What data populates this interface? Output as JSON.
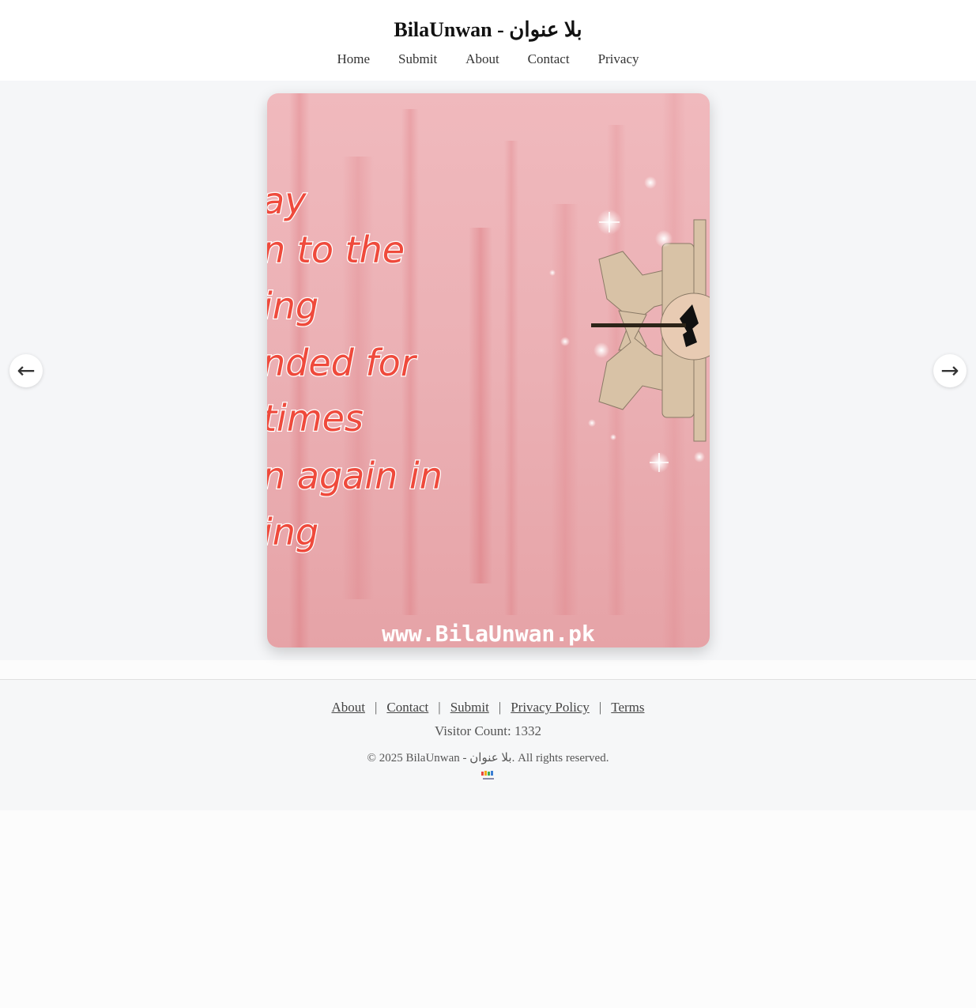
{
  "site": {
    "title": "BilaUnwan - بلا عنوان"
  },
  "nav": {
    "items": [
      {
        "label": "Home"
      },
      {
        "label": "Submit"
      },
      {
        "label": "About"
      },
      {
        "label": "Contact"
      },
      {
        "label": "Privacy"
      }
    ]
  },
  "slider": {
    "image_text_lines": [
      "ay",
      "n to the",
      "ing",
      "nded  for",
      "times",
      "n again in",
      "ing"
    ],
    "watermark": "www.BilaUnwan.pk",
    "prev_icon": "←",
    "next_icon": "→"
  },
  "footer": {
    "links": [
      {
        "label": "About"
      },
      {
        "label": "Contact"
      },
      {
        "label": "Submit"
      },
      {
        "label": "Privacy Policy"
      },
      {
        "label": "Terms"
      }
    ],
    "separator": "|",
    "visitor_count": "Visitor Count: 1332",
    "copyright": "© 2025 BilaUnwan - بلا عنوان. All rights reserved.",
    "logo_text": "BILA UNWAN"
  },
  "colors": {
    "slide_bg": "#eeb3b7",
    "slide_text": "#ef4a3c",
    "footer_bg": "#f6f7f8"
  }
}
